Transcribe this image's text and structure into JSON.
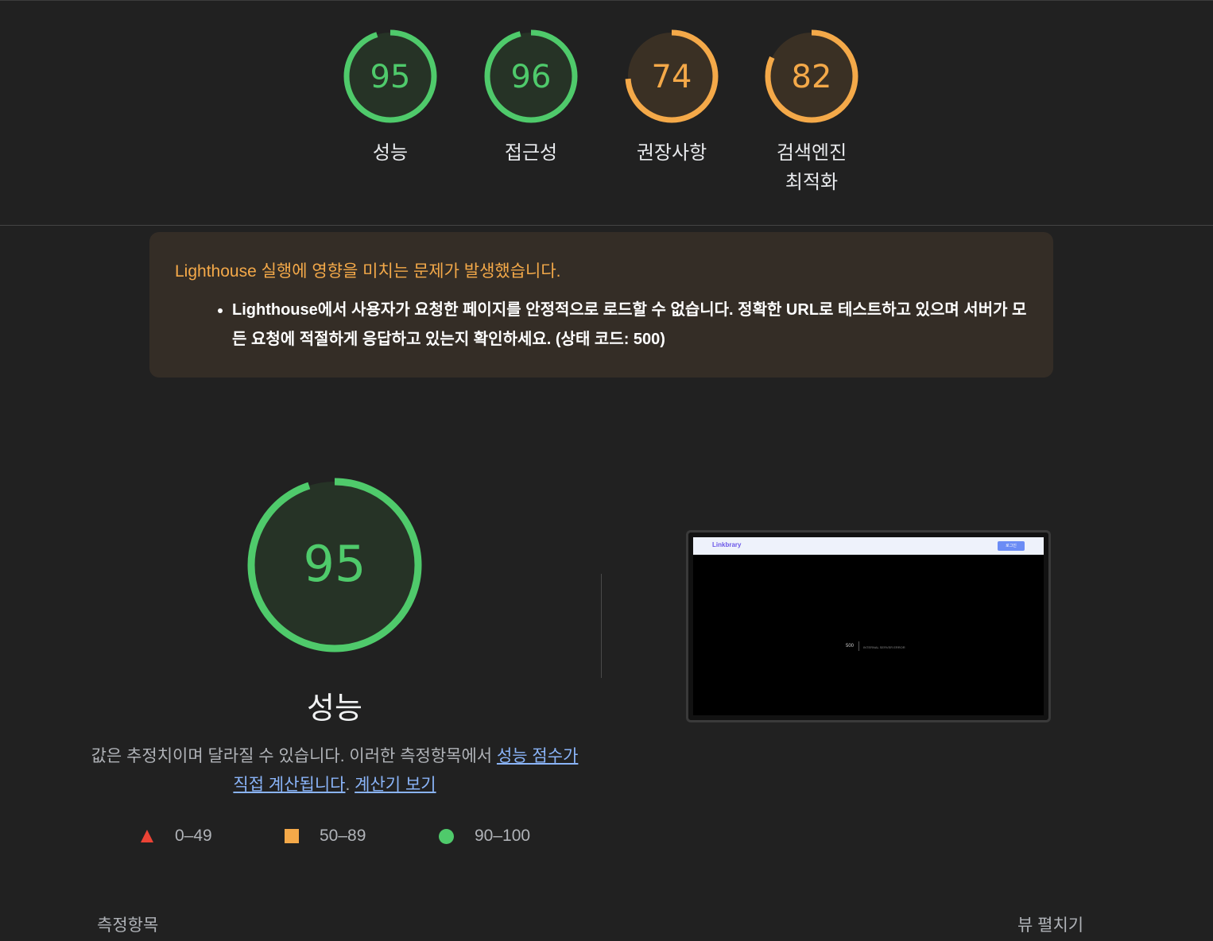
{
  "gauges": [
    {
      "score": "95",
      "label": "성능",
      "color": "#4fca6b",
      "fill": "#263326",
      "fraction": 0.95
    },
    {
      "score": "96",
      "label": "접근성",
      "color": "#4fca6b",
      "fill": "#263326",
      "fraction": 0.96
    },
    {
      "score": "74",
      "label": "권장사항",
      "color": "#f4a949",
      "fill": "#3a3024",
      "fraction": 0.74
    },
    {
      "score": "82",
      "label_line1": "검색엔진",
      "label_line2": "최적화",
      "color": "#f4a949",
      "fill": "#3a3024",
      "fraction": 0.82
    }
  ],
  "warning": {
    "title": "Lighthouse 실행에 영향을 미치는 문제가 발생했습니다.",
    "items": [
      "Lighthouse에서 사용자가 요청한 페이지를 안정적으로 로드할 수 없습니다. 정확한 URL로 테스트하고 있으며 서버가 모든 요청에 적절하게 응답하고 있는지 확인하세요. (상태 코드: 500)"
    ]
  },
  "performance": {
    "score": "95",
    "fraction": 0.95,
    "color": "#4fca6b",
    "title": "성능",
    "desc_text": "값은 추정치이며 달라질 수 있습니다. 이러한 측정항목에서 ",
    "desc_link1": "성능 점수가 직접 계산됩니다",
    "desc_mid": ". ",
    "desc_link2": "계산기 보기"
  },
  "legend": [
    {
      "range": "0–49",
      "icon": "triangle-icon",
      "color": "#eb4335"
    },
    {
      "range": "50–89",
      "icon": "square-icon",
      "color": "#f4a949"
    },
    {
      "range": "90–100",
      "icon": "circle-icon",
      "color": "#4fca6b"
    }
  ],
  "screenshot": {
    "logo": "Linkbrary",
    "button": "로그인",
    "code": "500",
    "message": "INTERNAL SERVER ERROR"
  },
  "footer": {
    "metrics_label": "측정항목",
    "expand_view": "뷰 펼치기"
  }
}
